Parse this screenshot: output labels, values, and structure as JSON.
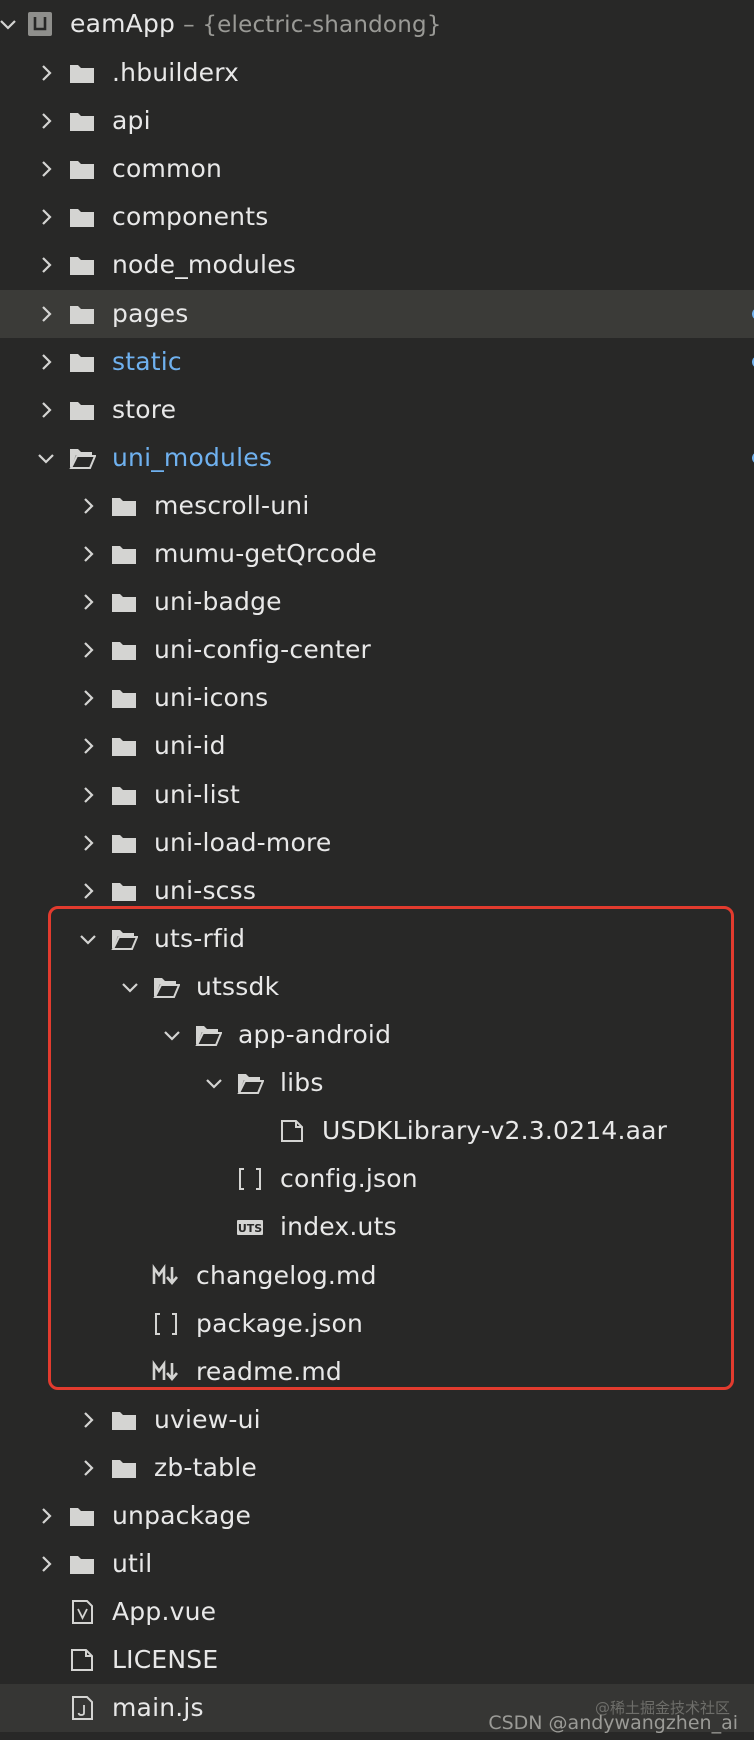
{
  "project": {
    "name": "eamApp",
    "subtitle": "– {electric-shandong}"
  },
  "tree": [
    {
      "label": ".hbuilderx",
      "type": "folder",
      "depth": 1,
      "expanded": false
    },
    {
      "label": "api",
      "type": "folder",
      "depth": 1,
      "expanded": false
    },
    {
      "label": "common",
      "type": "folder",
      "depth": 1,
      "expanded": false
    },
    {
      "label": "components",
      "type": "folder",
      "depth": 1,
      "expanded": false
    },
    {
      "label": "node_modules",
      "type": "folder",
      "depth": 1,
      "expanded": false
    },
    {
      "label": "pages",
      "type": "folder",
      "depth": 1,
      "expanded": false,
      "selected": true,
      "modified_dot": true
    },
    {
      "label": "static",
      "type": "folder",
      "depth": 1,
      "expanded": false,
      "modified": true,
      "modified_dot": true
    },
    {
      "label": "store",
      "type": "folder",
      "depth": 1,
      "expanded": false
    },
    {
      "label": "uni_modules",
      "type": "folder",
      "depth": 1,
      "expanded": true,
      "modified": true,
      "modified_dot": true
    },
    {
      "label": "mescroll-uni",
      "type": "folder",
      "depth": 2,
      "expanded": false
    },
    {
      "label": "mumu-getQrcode",
      "type": "folder",
      "depth": 2,
      "expanded": false
    },
    {
      "label": "uni-badge",
      "type": "folder",
      "depth": 2,
      "expanded": false
    },
    {
      "label": "uni-config-center",
      "type": "folder",
      "depth": 2,
      "expanded": false
    },
    {
      "label": "uni-icons",
      "type": "folder",
      "depth": 2,
      "expanded": false
    },
    {
      "label": "uni-id",
      "type": "folder",
      "depth": 2,
      "expanded": false
    },
    {
      "label": "uni-list",
      "type": "folder",
      "depth": 2,
      "expanded": false
    },
    {
      "label": "uni-load-more",
      "type": "folder",
      "depth": 2,
      "expanded": false
    },
    {
      "label": "uni-scss",
      "type": "folder",
      "depth": 2,
      "expanded": false
    },
    {
      "label": "uts-rfid",
      "type": "folder",
      "depth": 2,
      "expanded": true
    },
    {
      "label": "utssdk",
      "type": "folder",
      "depth": 3,
      "expanded": true
    },
    {
      "label": "app-android",
      "type": "folder",
      "depth": 4,
      "expanded": true
    },
    {
      "label": "libs",
      "type": "folder",
      "depth": 5,
      "expanded": true
    },
    {
      "label": "USDKLibrary-v2.3.0214.aar",
      "type": "file",
      "depth": 6
    },
    {
      "label": "config.json",
      "type": "json",
      "depth": 5
    },
    {
      "label": "index.uts",
      "type": "uts",
      "depth": 5
    },
    {
      "label": "changelog.md",
      "type": "md",
      "depth": 3
    },
    {
      "label": "package.json",
      "type": "json",
      "depth": 3
    },
    {
      "label": "readme.md",
      "type": "md",
      "depth": 3
    },
    {
      "label": "uview-ui",
      "type": "folder",
      "depth": 2,
      "expanded": false
    },
    {
      "label": "zb-table",
      "type": "folder",
      "depth": 2,
      "expanded": false
    },
    {
      "label": "unpackage",
      "type": "folder",
      "depth": 1,
      "expanded": false
    },
    {
      "label": "util",
      "type": "folder",
      "depth": 1,
      "expanded": false
    },
    {
      "label": "App.vue",
      "type": "vue",
      "depth": 1
    },
    {
      "label": "LICENSE",
      "type": "file",
      "depth": 1
    },
    {
      "label": "main.js",
      "type": "js",
      "depth": 1,
      "active": true
    }
  ],
  "watermark": {
    "site": "@稀土掘金技术社区",
    "author": "CSDN @andywangzhen_ai"
  },
  "colors": {
    "background": "#282827",
    "text": "#e8e8e8",
    "modified": "#6fb1ef",
    "highlight_box": "#e23b2e",
    "icon": "#d4d4d2"
  }
}
